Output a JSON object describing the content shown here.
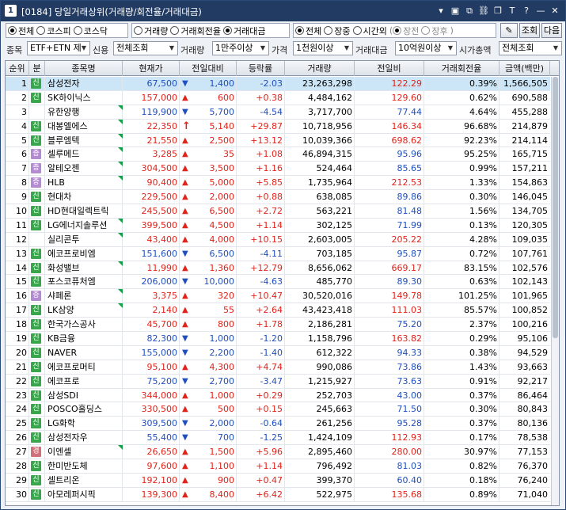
{
  "window": {
    "number": "1",
    "title": "[0184] 당일거래상위(거래량/회전율/거래대금)",
    "title_icons": [
      "chevron-down-icon",
      "memo-icon",
      "window-icon",
      "link-icon",
      "multi-window-icon",
      "font-icon",
      "help-icon",
      "minimize-icon",
      "close-icon"
    ],
    "title_icon_glyphs": [
      "▾",
      "▣",
      "⧉",
      "⛓",
      "❐",
      "T",
      "?",
      "—",
      "✕"
    ]
  },
  "filters": {
    "market": {
      "options": [
        "전체",
        "코스피",
        "코스닥"
      ],
      "selected": 0
    },
    "sort": {
      "options": [
        "거래량",
        "거래회전율",
        "거래대금"
      ],
      "selected": 2
    },
    "session": {
      "options": [
        "전체",
        "장중",
        "시간외"
      ],
      "selected": 0
    },
    "session_sub": {
      "options": [
        "장전",
        "장후"
      ],
      "selected": 0
    },
    "query_button": "조회",
    "next_button": "다음"
  },
  "conditions": {
    "item_label": "종목",
    "item_value": "ETF+ETN 제",
    "credit_label": "신용",
    "credit_value": "전체조회",
    "volume_label": "거래량",
    "volume_value": "1만주이상",
    "price_label": "가격",
    "price_value": "1천원이상",
    "amount_label": "거래대금",
    "amount_value": "10억원이상",
    "cap_label": "시가총액",
    "cap_value": "전체조회"
  },
  "table": {
    "headers": [
      "순위",
      "분",
      "종목명",
      "현재가",
      "전일대비",
      "등락률",
      "거래량",
      "전일비",
      "거래회전율",
      "금액(백만)"
    ],
    "rows": [
      {
        "rank": "1",
        "badge": "신",
        "name": "삼성전자",
        "mark": false,
        "price": "67,500",
        "dir": "dn",
        "chg": "1,400",
        "rate": "-2.03",
        "vol": "23,263,298",
        "prev": "122.29",
        "prevdir": "up",
        "turn": "0.39%",
        "amt": "1,566,505"
      },
      {
        "rank": "2",
        "badge": "신",
        "name": "SK하이닉스",
        "mark": false,
        "price": "157,000",
        "dir": "up",
        "chg": "600",
        "rate": "+0.38",
        "vol": "4,484,162",
        "prev": "129.60",
        "prevdir": "up",
        "turn": "0.62%",
        "amt": "690,588"
      },
      {
        "rank": "3",
        "badge": "",
        "name": "유한양행",
        "mark": true,
        "price": "119,900",
        "dir": "dn",
        "chg": "5,700",
        "rate": "-4.54",
        "vol": "3,717,700",
        "prev": "77.44",
        "prevdir": "dn",
        "turn": "4.64%",
        "amt": "455,288"
      },
      {
        "rank": "4",
        "badge": "신",
        "name": "대봉엘에스",
        "mark": true,
        "price": "22,350",
        "dir": "upper",
        "chg": "5,140",
        "rate": "+29.87",
        "vol": "10,718,956",
        "prev": "146.34",
        "prevdir": "up",
        "turn": "96.68%",
        "amt": "214,879"
      },
      {
        "rank": "5",
        "badge": "신",
        "name": "블루엠텍",
        "mark": true,
        "price": "21,550",
        "dir": "up",
        "chg": "2,500",
        "rate": "+13.12",
        "vol": "10,039,366",
        "prev": "698.62",
        "prevdir": "up",
        "turn": "92.23%",
        "amt": "214,114"
      },
      {
        "rank": "6",
        "badge": "증",
        "name": "셀루메드",
        "mark": true,
        "price": "3,285",
        "dir": "up",
        "chg": "35",
        "rate": "+1.08",
        "vol": "46,894,315",
        "prev": "95.96",
        "prevdir": "dn",
        "turn": "95.25%",
        "amt": "165,715"
      },
      {
        "rank": "7",
        "badge": "증",
        "name": "알테오젠",
        "mark": true,
        "price": "304,500",
        "dir": "up",
        "chg": "3,500",
        "rate": "+1.16",
        "vol": "524,464",
        "prev": "85.65",
        "prevdir": "dn",
        "turn": "0.99%",
        "amt": "157,211"
      },
      {
        "rank": "8",
        "badge": "증",
        "name": "HLB",
        "mark": true,
        "price": "90,400",
        "dir": "up",
        "chg": "5,000",
        "rate": "+5.85",
        "vol": "1,735,964",
        "prev": "212.53",
        "prevdir": "up",
        "turn": "1.33%",
        "amt": "154,863"
      },
      {
        "rank": "9",
        "badge": "신",
        "name": "현대차",
        "mark": false,
        "price": "229,500",
        "dir": "up",
        "chg": "2,000",
        "rate": "+0.88",
        "vol": "638,085",
        "prev": "89.86",
        "prevdir": "dn",
        "turn": "0.30%",
        "amt": "146,045"
      },
      {
        "rank": "10",
        "badge": "신",
        "name": "HD현대일렉트릭",
        "mark": false,
        "price": "245,500",
        "dir": "up",
        "chg": "6,500",
        "rate": "+2.72",
        "vol": "563,221",
        "prev": "81.48",
        "prevdir": "dn",
        "turn": "1.56%",
        "amt": "134,705"
      },
      {
        "rank": "11",
        "badge": "신",
        "name": "LG에너지솔루션",
        "mark": true,
        "price": "399,500",
        "dir": "up",
        "chg": "4,500",
        "rate": "+1.14",
        "vol": "302,125",
        "prev": "71.99",
        "prevdir": "dn",
        "turn": "0.13%",
        "amt": "120,305"
      },
      {
        "rank": "12",
        "badge": "",
        "name": "실리콘투",
        "mark": true,
        "price": "43,400",
        "dir": "up",
        "chg": "4,000",
        "rate": "+10.15",
        "vol": "2,603,005",
        "prev": "205.22",
        "prevdir": "up",
        "turn": "4.28%",
        "amt": "109,035"
      },
      {
        "rank": "13",
        "badge": "신",
        "name": "에코프로비엠",
        "mark": false,
        "price": "151,600",
        "dir": "dn",
        "chg": "6,500",
        "rate": "-4.11",
        "vol": "703,185",
        "prev": "95.87",
        "prevdir": "dn",
        "turn": "0.72%",
        "amt": "107,761"
      },
      {
        "rank": "14",
        "badge": "신",
        "name": "화성밸브",
        "mark": true,
        "price": "11,990",
        "dir": "up",
        "chg": "1,360",
        "rate": "+12.79",
        "vol": "8,656,062",
        "prev": "669.17",
        "prevdir": "up",
        "turn": "83.15%",
        "amt": "102,576"
      },
      {
        "rank": "15",
        "badge": "신",
        "name": "포스코퓨처엠",
        "mark": false,
        "price": "206,000",
        "dir": "dn",
        "chg": "10,000",
        "rate": "-4.63",
        "vol": "485,770",
        "prev": "89.30",
        "prevdir": "dn",
        "turn": "0.63%",
        "amt": "102,143"
      },
      {
        "rank": "16",
        "badge": "증",
        "name": "샤페론",
        "mark": true,
        "price": "3,375",
        "dir": "up",
        "chg": "320",
        "rate": "+10.47",
        "vol": "30,520,016",
        "prev": "149.78",
        "prevdir": "up",
        "turn": "101.25%",
        "amt": "101,965"
      },
      {
        "rank": "17",
        "badge": "신",
        "name": "LK삼양",
        "mark": true,
        "price": "2,140",
        "dir": "up",
        "chg": "55",
        "rate": "+2.64",
        "vol": "43,423,418",
        "prev": "111.03",
        "prevdir": "up",
        "turn": "85.57%",
        "amt": "100,852"
      },
      {
        "rank": "18",
        "badge": "신",
        "name": "한국가스공사",
        "mark": false,
        "price": "45,700",
        "dir": "up",
        "chg": "800",
        "rate": "+1.78",
        "vol": "2,186,281",
        "prev": "75.20",
        "prevdir": "dn",
        "turn": "2.37%",
        "amt": "100,216"
      },
      {
        "rank": "19",
        "badge": "신",
        "name": "KB금융",
        "mark": false,
        "price": "82,300",
        "dir": "dn",
        "chg": "1,000",
        "rate": "-1.20",
        "vol": "1,158,796",
        "prev": "163.82",
        "prevdir": "up",
        "turn": "0.29%",
        "amt": "95,106"
      },
      {
        "rank": "20",
        "badge": "신",
        "name": "NAVER",
        "mark": false,
        "price": "155,000",
        "dir": "dn",
        "chg": "2,200",
        "rate": "-1.40",
        "vol": "612,322",
        "prev": "94.33",
        "prevdir": "dn",
        "turn": "0.38%",
        "amt": "94,529"
      },
      {
        "rank": "21",
        "badge": "신",
        "name": "에코프로머티",
        "mark": false,
        "price": "95,100",
        "dir": "up",
        "chg": "4,300",
        "rate": "+4.74",
        "vol": "990,086",
        "prev": "73.86",
        "prevdir": "dn",
        "turn": "1.43%",
        "amt": "93,663"
      },
      {
        "rank": "22",
        "badge": "신",
        "name": "에코프로",
        "mark": false,
        "price": "75,200",
        "dir": "dn",
        "chg": "2,700",
        "rate": "-3.47",
        "vol": "1,215,927",
        "prev": "73.63",
        "prevdir": "dn",
        "turn": "0.91%",
        "amt": "92,217"
      },
      {
        "rank": "23",
        "badge": "신",
        "name": "삼성SDI",
        "mark": false,
        "price": "344,000",
        "dir": "up",
        "chg": "1,000",
        "rate": "+0.29",
        "vol": "252,703",
        "prev": "43.00",
        "prevdir": "dn",
        "turn": "0.37%",
        "amt": "86,464"
      },
      {
        "rank": "24",
        "badge": "신",
        "name": "POSCO홀딩스",
        "mark": false,
        "price": "330,500",
        "dir": "up",
        "chg": "500",
        "rate": "+0.15",
        "vol": "245,663",
        "prev": "71.50",
        "prevdir": "dn",
        "turn": "0.30%",
        "amt": "80,843"
      },
      {
        "rank": "25",
        "badge": "신",
        "name": "LG화학",
        "mark": false,
        "price": "309,500",
        "dir": "dn",
        "chg": "2,000",
        "rate": "-0.64",
        "vol": "261,256",
        "prev": "95.28",
        "prevdir": "dn",
        "turn": "0.37%",
        "amt": "80,136"
      },
      {
        "rank": "26",
        "badge": "신",
        "name": "삼성전자우",
        "mark": false,
        "price": "55,400",
        "dir": "dn",
        "chg": "700",
        "rate": "-1.25",
        "vol": "1,424,109",
        "prev": "112.93",
        "prevdir": "up",
        "turn": "0.17%",
        "amt": "78,538"
      },
      {
        "rank": "27",
        "badge": "경",
        "name": "이엔셀",
        "mark": true,
        "price": "26,650",
        "dir": "up",
        "chg": "1,500",
        "rate": "+5.96",
        "vol": "2,895,460",
        "prev": "280.00",
        "prevdir": "up",
        "turn": "30.97%",
        "amt": "77,153"
      },
      {
        "rank": "28",
        "badge": "신",
        "name": "한미반도체",
        "mark": false,
        "price": "97,600",
        "dir": "up",
        "chg": "1,100",
        "rate": "+1.14",
        "vol": "796,492",
        "prev": "81.03",
        "prevdir": "dn",
        "turn": "0.82%",
        "amt": "76,370"
      },
      {
        "rank": "29",
        "badge": "신",
        "name": "셀트리온",
        "mark": false,
        "price": "192,100",
        "dir": "up",
        "chg": "900",
        "rate": "+0.47",
        "vol": "399,370",
        "prev": "60.40",
        "prevdir": "dn",
        "turn": "0.18%",
        "amt": "76,240"
      },
      {
        "rank": "30",
        "badge": "신",
        "name": "아모레퍼시픽",
        "mark": false,
        "price": "139,300",
        "dir": "up",
        "chg": "8,400",
        "rate": "+6.42",
        "vol": "522,975",
        "prev": "135.68",
        "prevdir": "up",
        "turn": "0.89%",
        "amt": "71,040"
      }
    ]
  },
  "colors": {
    "titlebar": "#223b63",
    "up": "#e2231a",
    "down": "#1f4fbf",
    "selected_row": "#cde6f7",
    "badge_shin": "#38a64b",
    "badge_jeung": "#b48ad0",
    "badge_gyeong": "#d0707a",
    "new_mark": "#15a04a"
  }
}
